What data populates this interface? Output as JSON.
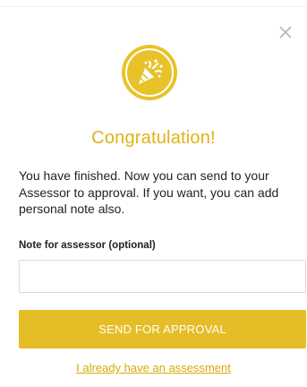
{
  "dialog": {
    "close_icon": "close-icon",
    "hero_icon": "party-popper-icon",
    "title": "Congratulation!",
    "message": "You have finished. Now you can send to your Assessor to approval. If you want, you can add personal note also.",
    "note_label": "Note for assessor (optional)",
    "note_value": "",
    "note_placeholder": "",
    "send_button_label": "SEND FOR APPROVAL",
    "assessment_link_label": "I already have an assessment"
  },
  "colors": {
    "accent": "#e5bd27",
    "title": "#e0b315",
    "link": "#d9a90a",
    "close": "#b5b5b5"
  }
}
